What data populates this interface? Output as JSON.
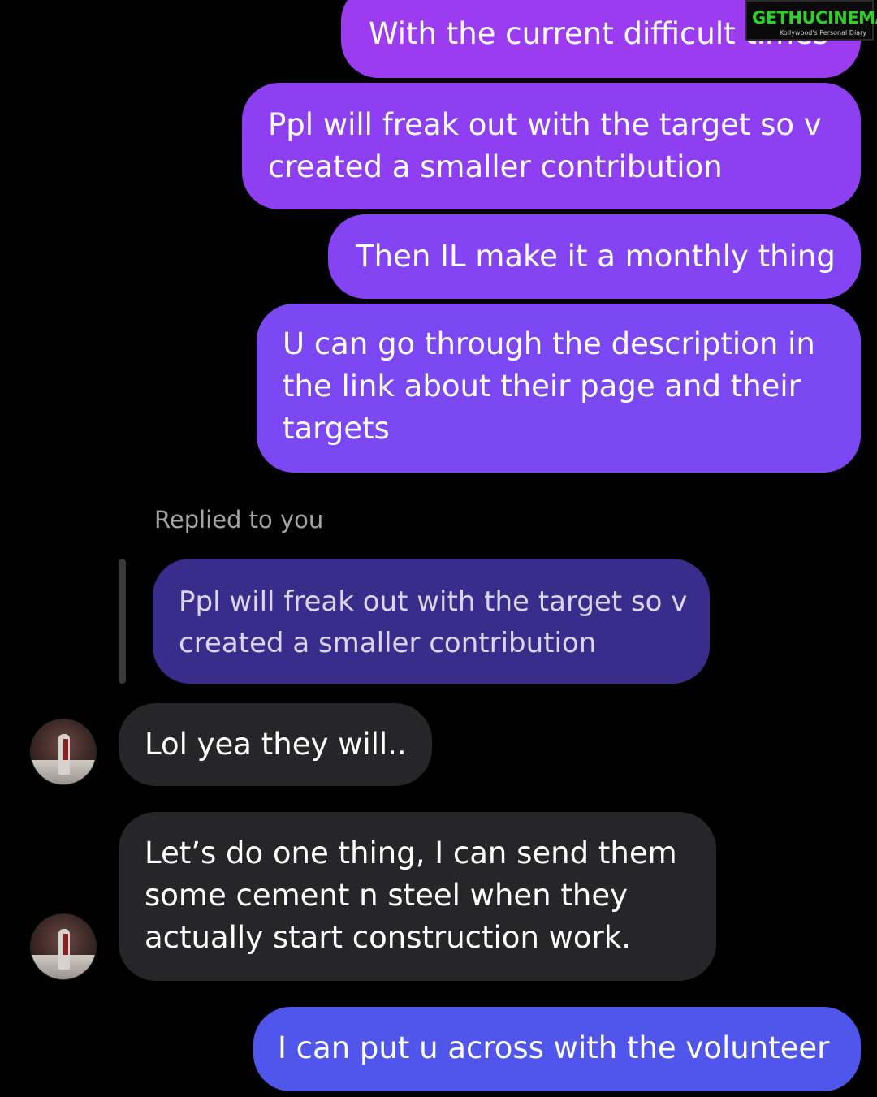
{
  "messages": {
    "out1": {
      "lines": [
        "With the current difficult times"
      ]
    },
    "out2": {
      "lines": [
        "Ppl will freak out with the target so v",
        "created a smaller contribution"
      ]
    },
    "out3": {
      "lines": [
        "Then IL make it a monthly thing"
      ]
    },
    "out4": {
      "lines": [
        "U can go through the description in",
        "the link about their page and their",
        "targets"
      ]
    },
    "reply_label": "Replied to you",
    "quoted": {
      "lines": [
        "Ppl will freak out with the target so v",
        "created a smaller contribution"
      ]
    },
    "in1": {
      "lines": [
        "Lol yea they will.."
      ]
    },
    "in2": {
      "lines": [
        "Let’s do one thing, I can send them",
        "some cement n steel when they",
        "actually start construction work."
      ]
    },
    "out5": {
      "lines": [
        "I can put u across with the volunteer"
      ]
    }
  },
  "watermark": {
    "main": "GETHUCINEMA",
    "sub": "Kollywood's Personal Diary"
  },
  "colors": {
    "background": "#000000",
    "outgoing_top": "#9b3cf0",
    "outgoing_bottom": "#5056ec",
    "incoming": "#262628",
    "quoted": "#3a2c8a",
    "watermark_green": "#2fd126"
  }
}
